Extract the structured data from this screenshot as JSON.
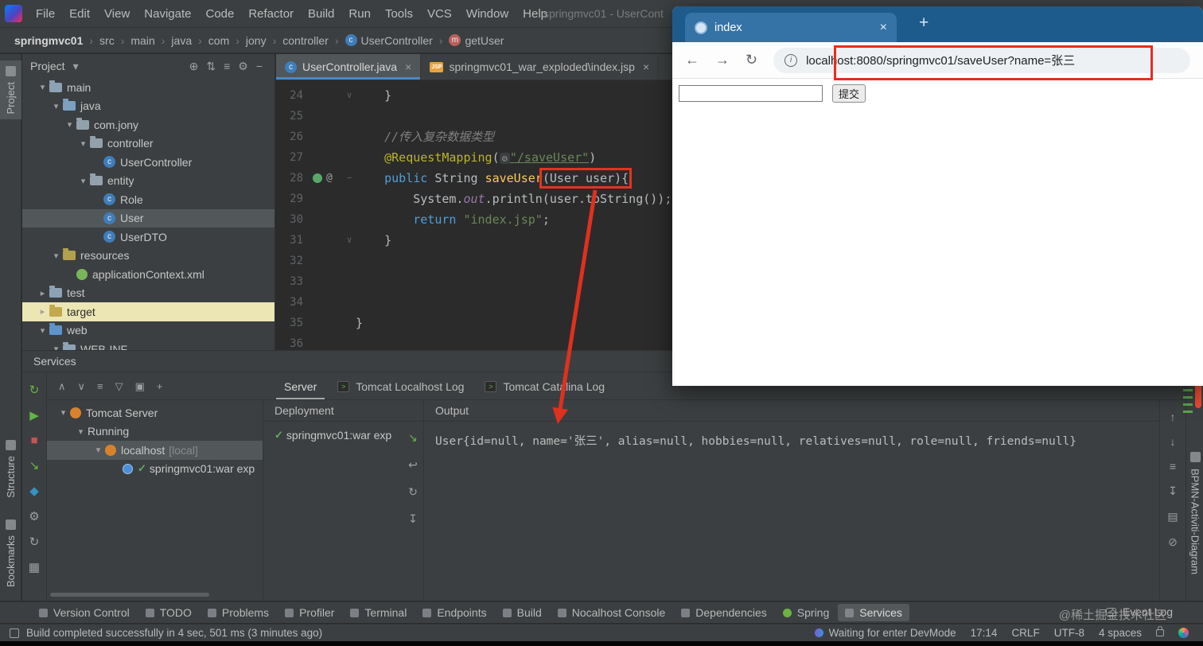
{
  "window_title": "springmvc01 - UserCont",
  "menu": {
    "items": [
      "File",
      "Edit",
      "View",
      "Navigate",
      "Code",
      "Refactor",
      "Build",
      "Run",
      "Tools",
      "VCS",
      "Window",
      "Help"
    ]
  },
  "breadcrumb": {
    "items": [
      {
        "label": "springmvc01",
        "bold": true
      },
      {
        "label": "src"
      },
      {
        "label": "main"
      },
      {
        "label": "java"
      },
      {
        "label": "com"
      },
      {
        "label": "jony"
      },
      {
        "label": "controller"
      },
      {
        "label": "UserController",
        "icon": "class"
      },
      {
        "label": "getUser",
        "icon": "method"
      }
    ]
  },
  "left_strip": {
    "items": [
      "Project",
      "Structure",
      "Bookmarks"
    ]
  },
  "right_strip": {
    "label": "BPMN-Activiti-Diagram"
  },
  "glyphs": {
    "chevron_right": "›",
    "caret_down": "▾",
    "caret_right": "▸",
    "close": "×",
    "at": "@",
    "check": "✓",
    "plus": "+",
    "back": "←",
    "forward": "→",
    "reload": "↻",
    "info": "i",
    "jsp": "JSP",
    "console": ">",
    "fold_open": "∨",
    "fold_line": "−",
    "class_letter": "c",
    "method_letter": "m",
    "gear_inlay": "⚙"
  },
  "project": {
    "title": "Project",
    "toolbar": [
      {
        "glyph": "⊕",
        "name": "locate-file-icon"
      },
      {
        "glyph": "⇅",
        "name": "expand-collapse-icon"
      },
      {
        "glyph": "≡",
        "name": "options-icon"
      },
      {
        "glyph": "⚙",
        "name": "settings-icon"
      },
      {
        "glyph": "−",
        "name": "hide-panel-icon"
      }
    ],
    "tree": [
      {
        "label": "main",
        "depth": 2,
        "chevron": "open",
        "icon": "folder"
      },
      {
        "label": "java",
        "depth": 3,
        "chevron": "open",
        "icon": "folder-src"
      },
      {
        "label": "com.jony",
        "depth": 4,
        "chevron": "open",
        "icon": "package"
      },
      {
        "label": "controller",
        "depth": 5,
        "chevron": "open",
        "icon": "package"
      },
      {
        "label": "UserController",
        "depth": 6,
        "icon": "class"
      },
      {
        "label": "entity",
        "depth": 5,
        "chevron": "open",
        "icon": "package"
      },
      {
        "label": "Role",
        "depth": 6,
        "icon": "class"
      },
      {
        "label": "User",
        "depth": 6,
        "icon": "class",
        "selected": true
      },
      {
        "label": "UserDTO",
        "depth": 6,
        "icon": "class"
      },
      {
        "label": "resources",
        "depth": 3,
        "chevron": "open",
        "icon": "folder-res"
      },
      {
        "label": "applicationContext.xml",
        "depth": 4,
        "icon": "spring"
      },
      {
        "label": "test",
        "depth": 2,
        "chevron": "closed",
        "icon": "folder"
      },
      {
        "label": "target",
        "depth": 2,
        "chevron": "closed",
        "icon": "folder-target",
        "highlight": true
      },
      {
        "label": "web",
        "depth": 2,
        "chevron": "open",
        "icon": "folder-web"
      },
      {
        "label": "WEB-INF",
        "depth": 3,
        "chevron": "open",
        "icon": "folder"
      }
    ]
  },
  "editor": {
    "tabs": [
      {
        "label": "UserController.java",
        "icon": "class",
        "active": true
      },
      {
        "label": "springmvc01_war_exploded\\index.jsp",
        "icon": "jsp",
        "active": false
      }
    ],
    "lines": [
      {
        "num": "24",
        "fold": "open",
        "tokens": [
          [
            "    }",
            "plain"
          ]
        ]
      },
      {
        "num": "25",
        "tokens": []
      },
      {
        "num": "26",
        "tokens": [
          [
            "    ",
            "plain"
          ],
          [
            "//传入复杂数据类型",
            "comment"
          ]
        ]
      },
      {
        "num": "27",
        "tokens": [
          [
            "    ",
            "plain"
          ],
          [
            "@RequestMapping",
            "annotation"
          ],
          [
            "(",
            "plain"
          ],
          [
            "⚙",
            "inlay"
          ],
          [
            "\"/saveUser\"",
            "stringlink"
          ],
          [
            ")",
            "plain"
          ]
        ]
      },
      {
        "num": "28",
        "mapped": true,
        "fold": "line",
        "tokens": [
          [
            "    ",
            "plain"
          ],
          [
            "public ",
            "keyword"
          ],
          [
            "String ",
            "plain"
          ],
          [
            "saveUser",
            "method"
          ],
          [
            "(User user){",
            "plain box"
          ]
        ]
      },
      {
        "num": "29",
        "tokens": [
          [
            "        ",
            "plain"
          ],
          [
            "System.",
            "plain"
          ],
          [
            "out",
            "field"
          ],
          [
            ".println(user.toString());",
            "plain"
          ]
        ]
      },
      {
        "num": "30",
        "tokens": [
          [
            "        ",
            "plain"
          ],
          [
            "return ",
            "keyword"
          ],
          [
            "\"index.jsp\"",
            "string"
          ],
          [
            ";",
            "plain"
          ]
        ]
      },
      {
        "num": "31",
        "fold": "open",
        "tokens": [
          [
            "    }",
            "plain"
          ]
        ]
      },
      {
        "num": "32",
        "tokens": []
      },
      {
        "num": "33",
        "tokens": []
      },
      {
        "num": "34",
        "tokens": []
      },
      {
        "num": "35",
        "tokens": [
          [
            "}",
            "plain"
          ]
        ]
      },
      {
        "num": "36",
        "tokens": []
      }
    ]
  },
  "browser": {
    "tab_title": "index",
    "url": "localhost:8080/springmvc01/saveUser?name=张三",
    "input_value": "",
    "submit_label": "提交"
  },
  "services": {
    "title": "Services",
    "left_toolbar": [
      {
        "glyph": "↻",
        "color": "#62b543",
        "name": "rerun-server-icon"
      },
      {
        "glyph": "▶",
        "color": "#62b543",
        "name": "run-icon"
      },
      {
        "glyph": "■",
        "color": "#c75450",
        "name": "stop-icon"
      },
      {
        "glyph": "↘",
        "color": "#62b543",
        "name": "deploy-icon"
      },
      {
        "glyph": "◆",
        "color": "#3592c4",
        "name": "debug-icon"
      },
      {
        "glyph": "⚙",
        "color": "#9da0a3",
        "name": "settings-icon"
      },
      {
        "glyph": "↻",
        "color": "#9da0a3",
        "name": "refresh-icon"
      },
      {
        "glyph": "▦",
        "color": "#9da0a3",
        "name": "layout-icon"
      }
    ],
    "tree_toolbar": [
      {
        "glyph": "∧",
        "name": "collapse-all-icon"
      },
      {
        "glyph": "∨",
        "name": "expand-all-icon"
      },
      {
        "glyph": "≡",
        "name": "group-by-icon"
      },
      {
        "glyph": "▽",
        "name": "filter-icon"
      },
      {
        "glyph": "▣",
        "name": "float-mode-icon"
      },
      {
        "glyph": "+",
        "name": "add-service-icon"
      }
    ],
    "tabs": [
      {
        "label": "Server",
        "active": true
      },
      {
        "label": "Tomcat Localhost Log",
        "icon": "console"
      },
      {
        "label": "Tomcat Catalina Log",
        "icon": "console"
      }
    ],
    "tree": [
      {
        "label": "Tomcat Server",
        "depth": 0,
        "chevron": "open",
        "icon": "tomcat"
      },
      {
        "label": "Running",
        "depth": 1,
        "chevron": "open"
      },
      {
        "label": "localhost",
        "suffix": "[local]",
        "depth": 2,
        "chevron": "open",
        "icon": "tomcat",
        "selected": true
      },
      {
        "label": "springmvc01:war exp",
        "depth": 3,
        "icon": "war",
        "check": true
      }
    ],
    "deployment_header": "Deployment",
    "deployment_rows": [
      {
        "label": "springmvc01:war exp",
        "check": true
      }
    ],
    "deployment_icons": [
      {
        "glyph": "↘",
        "color": "#62b543",
        "name": "publish-icon"
      },
      {
        "glyph": "↩",
        "color": "#9da0a3",
        "name": "rollback-icon"
      },
      {
        "glyph": "↻",
        "color": "#9da0a3",
        "name": "redeploy-icon"
      },
      {
        "glyph": "↧",
        "color": "#9da0a3",
        "name": "download-icon"
      }
    ],
    "output_header": "Output",
    "output_text": "User{id=null, name='张三', alias=null, hobbies=null, relatives=null, role=null, friends=null}",
    "output_icons": [
      {
        "glyph": "↑",
        "name": "scroll-up-icon"
      },
      {
        "glyph": "↓",
        "name": "scroll-down-icon"
      },
      {
        "glyph": "≡",
        "name": "soft-wrap-icon"
      },
      {
        "glyph": "↧",
        "name": "scroll-to-end-icon"
      },
      {
        "glyph": "▤",
        "name": "print-icon"
      },
      {
        "glyph": "⊘",
        "name": "clear-output-icon"
      }
    ]
  },
  "bottom_bar": {
    "tabs": [
      {
        "label": "Version Control"
      },
      {
        "label": "TODO"
      },
      {
        "label": "Problems"
      },
      {
        "label": "Profiler"
      },
      {
        "label": "Terminal"
      },
      {
        "label": "Endpoints"
      },
      {
        "label": "Build"
      },
      {
        "label": "Nocalhost Console"
      },
      {
        "label": "Dependencies"
      },
      {
        "label": "Spring",
        "icon": "spring"
      },
      {
        "label": "Services",
        "active": true
      }
    ],
    "event_log": "Event Log",
    "watermark": "@稀土掘金技术社区"
  },
  "status_bar": {
    "left": "Build completed successfully in 4 sec, 501 ms (3 minutes ago)",
    "devmode": "Waiting for enter DevMode",
    "time": "17:14",
    "line_ending": "CRLF",
    "encoding": "UTF-8",
    "indent": "4 spaces"
  }
}
